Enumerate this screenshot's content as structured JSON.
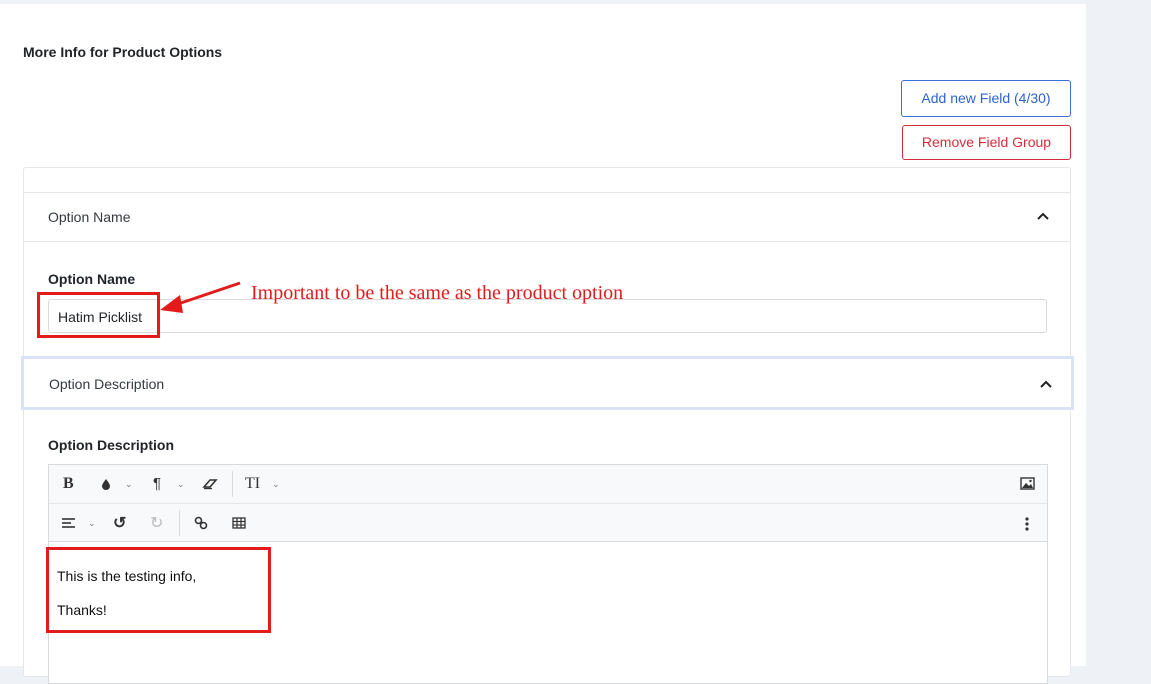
{
  "section": {
    "title": "More Info for Product Options"
  },
  "actions": {
    "add_field": "Add new Field (4/30)",
    "remove_group": "Remove Field Group"
  },
  "option_name": {
    "accordion_label": "Option Name",
    "field_label": "Option Name",
    "value": "Hatim Picklist"
  },
  "option_description": {
    "accordion_label": "Option Description",
    "field_label": "Option Description",
    "editor_lines": [
      "This is the testing info,",
      "Thanks!"
    ]
  },
  "toolbar": {
    "bold": "B",
    "text_size": "TI",
    "icons": [
      "bold-icon",
      "color-icon",
      "paragraph-icon",
      "eraser-icon",
      "text-size-icon",
      "image-icon",
      "align-icon",
      "undo-icon",
      "redo-icon",
      "link-icon",
      "table-icon",
      "more-vertical-icon"
    ]
  },
  "annotation": {
    "text": "Important to be the same as the product option",
    "color": "#e21b1b"
  },
  "colors": {
    "primary": "#2f62cf",
    "danger": "#d62d3c",
    "focus_outline": "#d9e2f6"
  }
}
